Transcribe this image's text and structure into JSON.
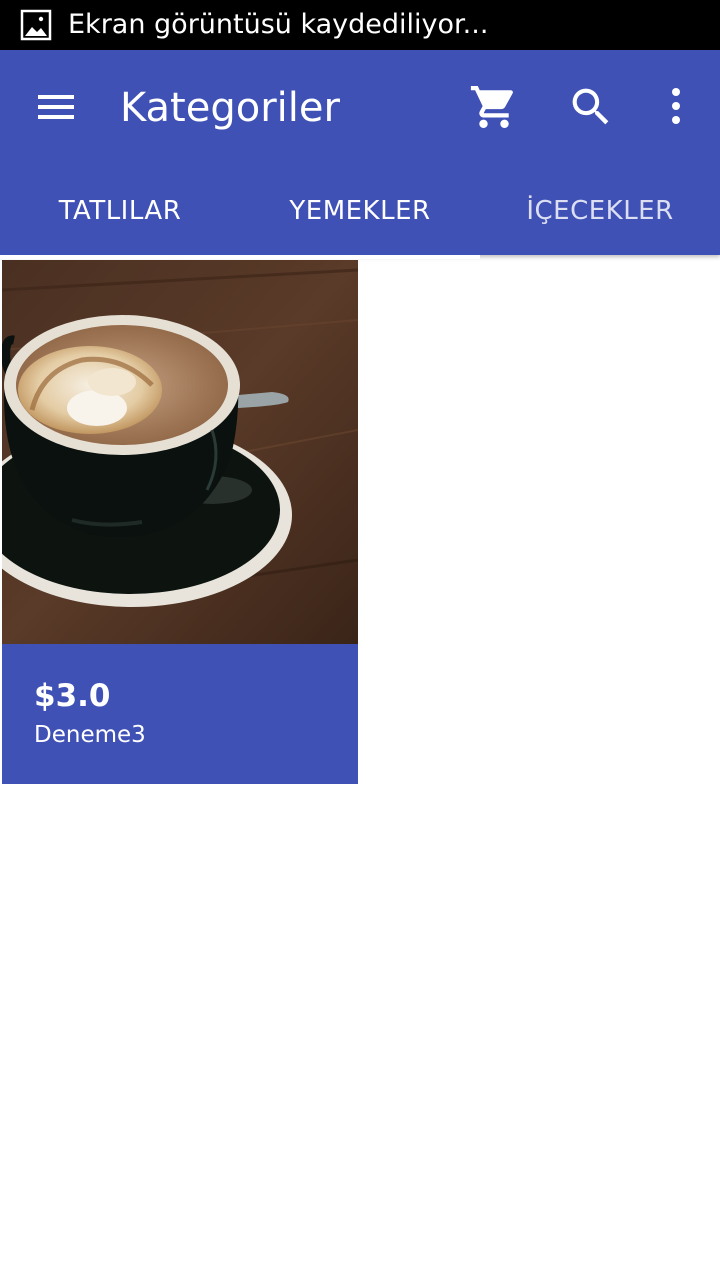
{
  "status_bar": {
    "notification_icon": "image-icon",
    "notification_text": "Ekran görüntüsü kaydediliyor..."
  },
  "app_bar": {
    "title": "Kategoriler",
    "menu_icon": "hamburger-menu-icon",
    "cart_icon": "cart-icon",
    "search_icon": "search-icon",
    "overflow_icon": "more-vert-icon",
    "background_color": "#3f51b5"
  },
  "tabs": [
    {
      "label": "TATLILAR"
    },
    {
      "label": "YEMEKLER"
    },
    {
      "label": "İÇECEKLER"
    }
  ],
  "products": [
    {
      "price": "$3.0",
      "name": "Deneme3",
      "image": "coffee-cup-photo"
    }
  ]
}
